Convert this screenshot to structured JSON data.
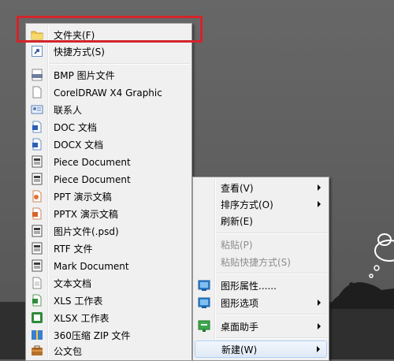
{
  "main_menu": {
    "items": [
      {
        "label": "文件夹(F)",
        "icon": "folder-icon"
      },
      {
        "label": "快捷方式(S)",
        "icon": "shortcut-icon"
      },
      {
        "label": "BMP 图片文件",
        "icon": "bmp-file-icon"
      },
      {
        "label": "CorelDRAW X4 Graphic",
        "icon": "blank-file-icon"
      },
      {
        "label": "联系人",
        "icon": "contact-icon"
      },
      {
        "label": "DOC 文档",
        "icon": "doc-file-icon"
      },
      {
        "label": "DOCX 文档",
        "icon": "docx-file-icon"
      },
      {
        "label": "Piece Document",
        "icon": "piece-document-icon"
      },
      {
        "label": "Piece Document",
        "icon": "piece-document-icon"
      },
      {
        "label": "PPT 演示文稿",
        "icon": "ppt-file-icon"
      },
      {
        "label": "PPTX 演示文稿",
        "icon": "pptx-file-icon"
      },
      {
        "label": "图片文件(.psd)",
        "icon": "psd-file-icon"
      },
      {
        "label": "RTF 文件",
        "icon": "rtf-file-icon"
      },
      {
        "label": "Mark Document",
        "icon": "mark-document-icon"
      },
      {
        "label": "文本文档",
        "icon": "text-file-icon"
      },
      {
        "label": "XLS 工作表",
        "icon": "xls-file-icon"
      },
      {
        "label": "XLSX 工作表",
        "icon": "xlsx-file-icon"
      },
      {
        "label": "360压缩 ZIP 文件",
        "icon": "zip-file-icon"
      },
      {
        "label": "公文包",
        "icon": "briefcase-icon"
      }
    ]
  },
  "sub_menu": {
    "items": [
      {
        "label": "查看(V)",
        "submenu": true
      },
      {
        "label": "排序方式(O)",
        "submenu": true
      },
      {
        "label": "刷新(E)"
      },
      {
        "label": "粘贴(P)",
        "disabled": true
      },
      {
        "label": "粘贴快捷方式(S)",
        "disabled": true
      },
      {
        "label": "图形属性......",
        "icon": "graphics-properties-icon"
      },
      {
        "label": "图形选项",
        "icon": "graphics-options-icon",
        "submenu": true
      },
      {
        "label": "桌面助手",
        "icon": "desktop-assistant-icon",
        "submenu": true
      },
      {
        "label": "新建(W)",
        "submenu": true,
        "active": true
      }
    ]
  },
  "colors": {
    "annotation_box": "#d4242a",
    "menu_background": "#f0f0f0",
    "active_item": "#dfe9f6"
  }
}
